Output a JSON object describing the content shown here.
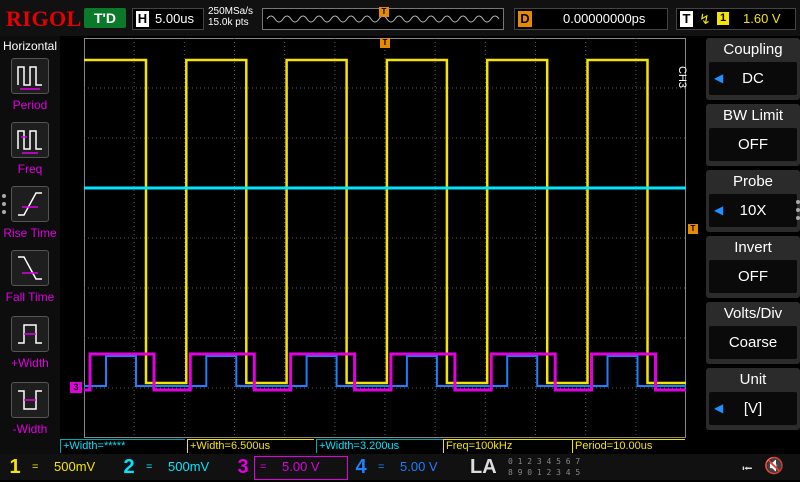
{
  "header": {
    "logo": "RIGOL",
    "trigger_status": "T'D",
    "horizontal_key": "H",
    "timebase": "5.00us",
    "sample_rate": "250MSa/s",
    "memory_points": "15.0k pts",
    "delay_key": "D",
    "delay_value": "0.00000000ps",
    "trigger_key": "T",
    "trigger_source": "1",
    "trigger_level": "1.60 V"
  },
  "left_menu": {
    "title": "Horizontal",
    "items": [
      {
        "label": "Period",
        "icon": "period-icon"
      },
      {
        "label": "Freq",
        "icon": "frequency-icon"
      },
      {
        "label": "Rise Time",
        "icon": "rise-time-icon"
      },
      {
        "label": "Fall Time",
        "icon": "fall-time-icon"
      },
      {
        "label": "+Width",
        "icon": "positive-width-icon"
      },
      {
        "label": "-Width",
        "icon": "negative-width-icon"
      }
    ]
  },
  "screen": {
    "trigger_marker": "T",
    "trigger_level_marker": "T",
    "ch3_marker": "3",
    "colors": {
      "ch1": "#f4e400",
      "ch2": "#00e5ff",
      "ch3": "#e000e0",
      "ch4": "#1e7fff",
      "grid": "#5a5a5a"
    }
  },
  "measurements": [
    {
      "text": "+Width=*****",
      "color": "cyan"
    },
    {
      "text": "+Width=6.500us",
      "color": "yellow"
    },
    {
      "text": "+Width=3.200us",
      "color": "cyan"
    },
    {
      "text": "Freq=100kHz",
      "color": "yellow"
    },
    {
      "text": "Period=10.00us",
      "color": "yellow"
    }
  ],
  "right_menu": {
    "channel_tag": "CH3",
    "items": [
      {
        "title": "Coupling",
        "value": "DC",
        "arrow": true
      },
      {
        "title": "BW Limit",
        "value": "OFF",
        "arrow": false
      },
      {
        "title": "Probe",
        "value": "10X",
        "arrow": true
      },
      {
        "title": "Invert",
        "value": "OFF",
        "arrow": false
      },
      {
        "title": "Volts/Div",
        "value": "Coarse",
        "arrow": false
      },
      {
        "title": "Unit",
        "value": "[V]",
        "arrow": true
      }
    ]
  },
  "channels": [
    {
      "number": "1",
      "coupling": "=",
      "scale": "500mV",
      "color": "#f4e400"
    },
    {
      "number": "2",
      "coupling": "=",
      "scale": "500mV",
      "color": "#00e5ff"
    },
    {
      "number": "3",
      "coupling": "=",
      "scale": "5.00 V",
      "color": "#e000e0"
    },
    {
      "number": "4",
      "coupling": "=",
      "scale": "5.00 V",
      "color": "#1e7fff"
    }
  ],
  "footer": {
    "la_label": "LA",
    "la_bits_top": "0 1 2 3  4 5 6 7",
    "la_bits_bottom": "8 9 0 1  2 3 4 5"
  }
}
